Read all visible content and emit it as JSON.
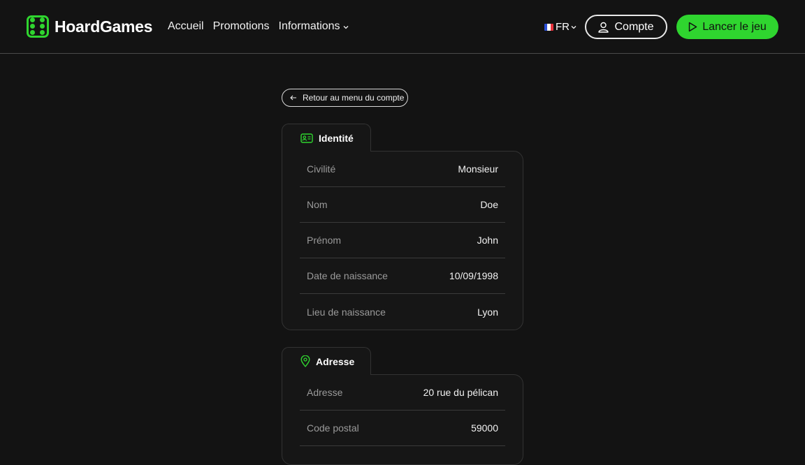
{
  "brand": {
    "name": "HoardGames",
    "color": "#2fd52f",
    "logo_icon": "dice-icon"
  },
  "nav": {
    "items": [
      {
        "label": "Accueil"
      },
      {
        "label": "Promotions"
      },
      {
        "label": "Informations"
      }
    ]
  },
  "header": {
    "language": "FR",
    "account_label": "Compte",
    "play_label": "Lancer le jeu"
  },
  "back": {
    "label": "Retour au menu du compte"
  },
  "identity": {
    "title": "Identité",
    "rows": [
      {
        "label": "Civilité",
        "value": "Monsieur"
      },
      {
        "label": "Nom",
        "value": "Doe"
      },
      {
        "label": "Prénom",
        "value": "John"
      },
      {
        "label": "Date de naissance",
        "value": "10/09/1998"
      },
      {
        "label": "Lieu de naissance",
        "value": "Lyon"
      }
    ]
  },
  "address": {
    "title": "Adresse",
    "rows": [
      {
        "label": "Adresse",
        "value": "20 rue du pélican"
      },
      {
        "label": "Code postal",
        "value": "59000"
      }
    ]
  }
}
